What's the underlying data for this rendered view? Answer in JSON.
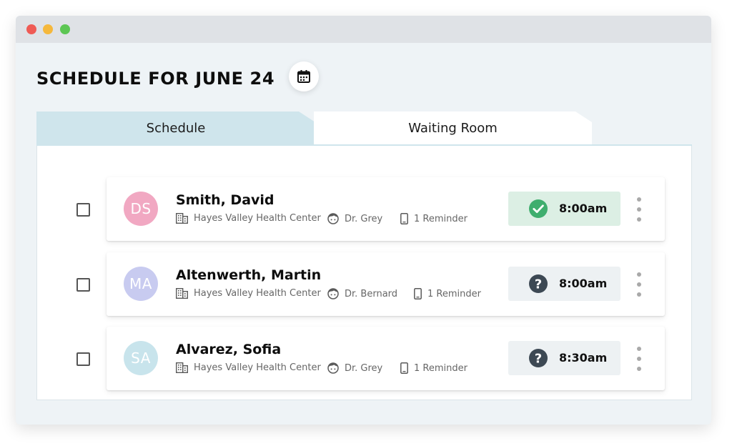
{
  "window": {
    "controls": [
      "close",
      "minimize",
      "maximize"
    ]
  },
  "header": {
    "title": "SCHEDULE FOR JUNE 24",
    "calendar_icon": "calendar-icon"
  },
  "tabs": [
    {
      "label": "Schedule",
      "active": true
    },
    {
      "label": "Waiting Room",
      "active": false
    }
  ],
  "colors": {
    "confirmed_bg": "#dcefe4",
    "confirmed_icon": "#3fae6e",
    "pending_bg": "#edf1f3",
    "pending_icon": "#3d4954",
    "tab_active": "#cfe5ec"
  },
  "appointments": [
    {
      "initials": "DS",
      "avatar_color": "#f1a8c2",
      "name": "Smith, David",
      "location": "Hayes Valley Health Center",
      "doctor": "Dr. Grey",
      "reminder": "1 Reminder",
      "status": "confirmed",
      "status_icon": "check-circle-icon",
      "time": "8:00am"
    },
    {
      "initials": "MA",
      "avatar_color": "#c8cbf0",
      "name": "Altenwerth, Martin",
      "location": "Hayes Valley Health Center",
      "doctor": "Dr. Bernard",
      "reminder": "1 Reminder",
      "status": "unconfirmed",
      "status_icon": "question-circle-icon",
      "time": "8:00am"
    },
    {
      "initials": "SA",
      "avatar_color": "#c8e4ec",
      "name": "Alvarez, Sofia",
      "location": "Hayes Valley Health Center",
      "doctor": "Dr. Grey",
      "reminder": "1 Reminder",
      "status": "unconfirmed",
      "status_icon": "question-circle-icon",
      "time": "8:30am"
    }
  ]
}
